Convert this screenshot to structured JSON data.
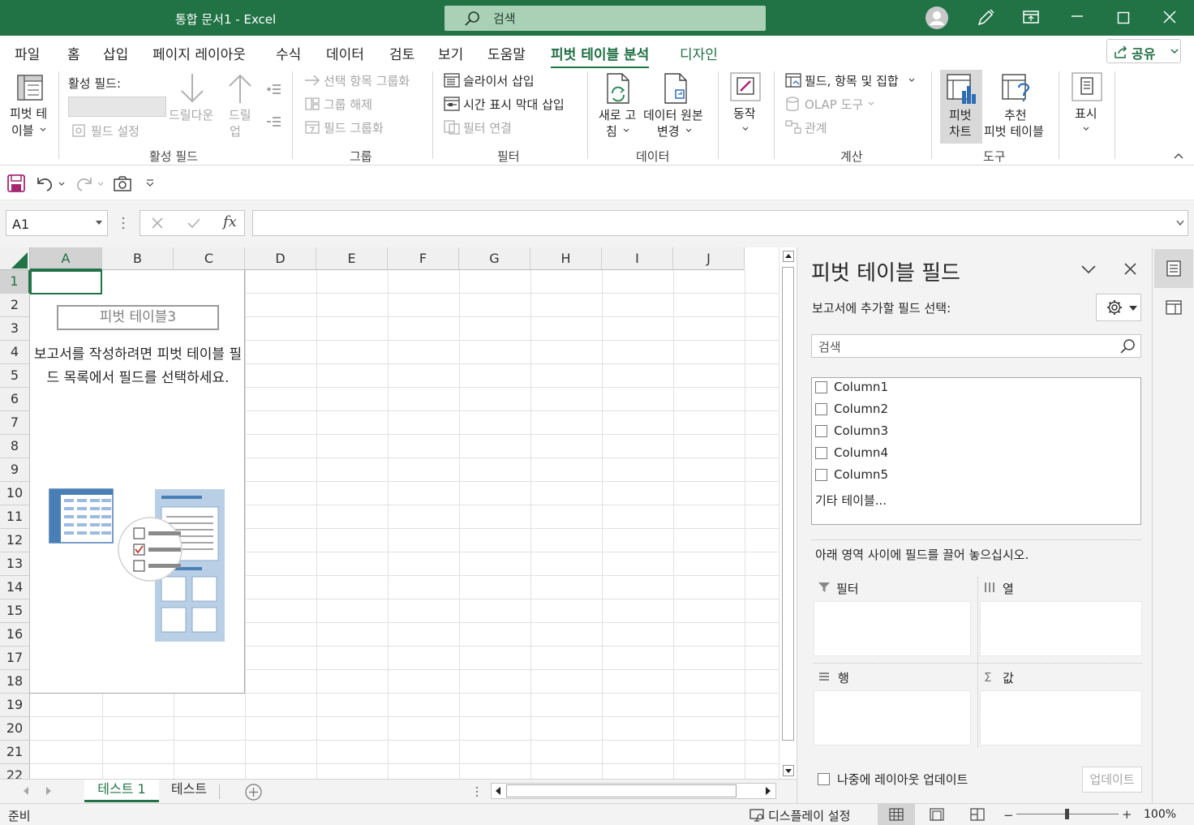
{
  "window": {
    "title": "통합 문서1  -  Excel",
    "search_placeholder": "검색"
  },
  "ribbon_tabs": [
    "파일",
    "홈",
    "삽입",
    "페이지 레이아웃",
    "수식",
    "데이터",
    "검토",
    "보기",
    "도움말",
    "피벗 테이블 분석",
    "디자인"
  ],
  "active_tab": "피벗 테이블 분석",
  "share_label": "공유",
  "ribbon": {
    "pivot_table_label_1": "피벗 테",
    "pivot_table_label_2": "이블",
    "active_field_label": "활성 필드:",
    "field_settings": "필드 설정",
    "drill_down": "드릴다운",
    "drill_up_1": "드릴",
    "drill_up_2": "업",
    "group_active_field": "활성 필드",
    "group_selection": "선택 항목 그룹화",
    "ungroup": "그룹 해제",
    "group_field": "필드 그룹화",
    "group_group": "그룹",
    "insert_slicer": "슬라이서 삽입",
    "insert_timeline": "시간 표시 막대 삽입",
    "filter_connections": "필터 연결",
    "group_filter": "필터",
    "refresh_1": "새로 고",
    "refresh_2": "침",
    "change_source_1": "데이터 원본",
    "change_source_2": "변경",
    "group_data": "데이터",
    "actions": "동작",
    "fields_items_sets": "필드, 항목 및 집합",
    "olap_tools": "OLAP 도구",
    "relationships": "관계",
    "group_calc": "계산",
    "pivot_chart_1": "피벗",
    "pivot_chart_2": "차트",
    "recommended_1": "추천",
    "recommended_2": "피벗 테이블",
    "group_tools": "도구",
    "show": "표시"
  },
  "namebox": "A1",
  "fx_symbol": "fx",
  "columns": [
    "A",
    "B",
    "C",
    "D",
    "E",
    "F",
    "G",
    "H",
    "I",
    "J"
  ],
  "rows": [
    "1",
    "2",
    "3",
    "4",
    "5",
    "6",
    "7",
    "8",
    "9",
    "10",
    "11",
    "12",
    "13",
    "14",
    "15",
    "16",
    "17",
    "18",
    "19",
    "20",
    "21",
    "22"
  ],
  "pivot_placeholder": {
    "title": "피벗 테이블3",
    "message": "보고서를 작성하려면 피벗 테이블 필드 목록에서 필드를 선택하세요."
  },
  "sheets": [
    "테스트 1",
    "테스트"
  ],
  "active_sheet": "테스트 1",
  "pane": {
    "title": "피벗 테이블 필드",
    "subtitle": "보고서에 추가할 필드 선택:",
    "search_placeholder": "검색",
    "fields": [
      "Column1",
      "Column2",
      "Column3",
      "Column4",
      "Column5"
    ],
    "more_tables": "기타 테이블...",
    "drag_message": "아래 영역 사이에 필드를 끌어 놓으십시오.",
    "areas": {
      "filter": "필터",
      "columns": "열",
      "rows": "행",
      "values": "값"
    },
    "defer_update": "나중에 레이아웃 업데이트",
    "update_button": "업데이트"
  },
  "status": {
    "ready": "준비",
    "display_settings": "디스플레이 설정",
    "zoom": "100%"
  },
  "colors": {
    "accent": "#217346",
    "titlebar": "#217346"
  }
}
